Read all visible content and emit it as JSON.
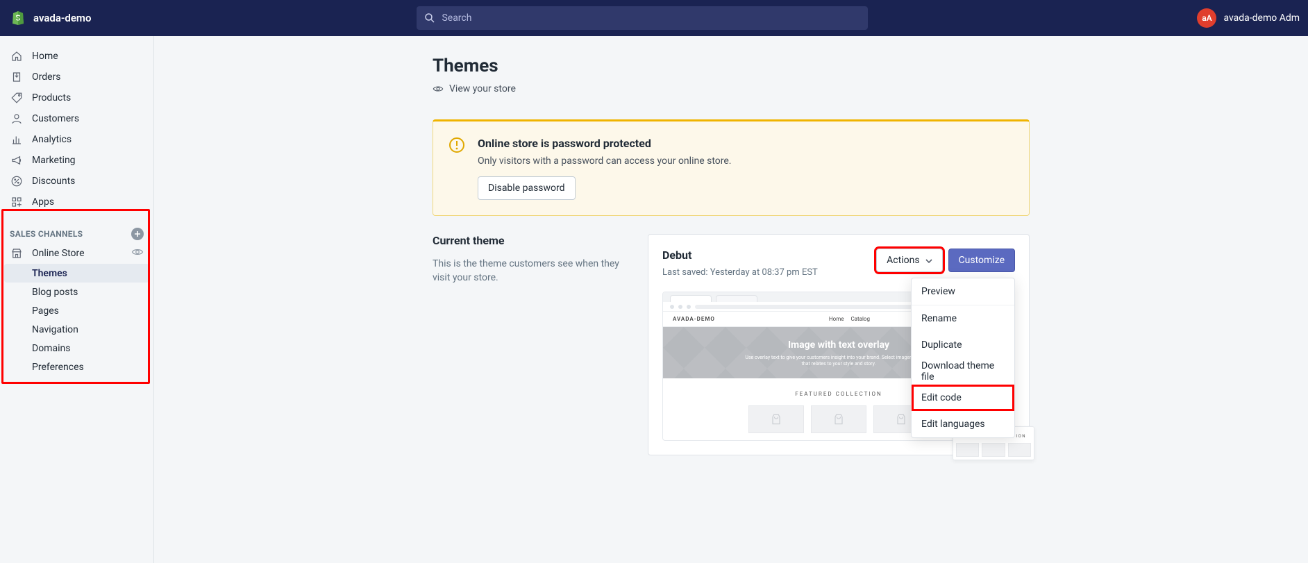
{
  "topbar": {
    "store_name": "avada-demo",
    "search_placeholder": "Search",
    "user_initials": "aA",
    "user_name": "avada-demo Adm"
  },
  "sidebar": {
    "items": [
      {
        "label": "Home"
      },
      {
        "label": "Orders"
      },
      {
        "label": "Products"
      },
      {
        "label": "Customers"
      },
      {
        "label": "Analytics"
      },
      {
        "label": "Marketing"
      },
      {
        "label": "Discounts"
      },
      {
        "label": "Apps"
      }
    ],
    "channels_header": "SALES CHANNELS",
    "online_store": "Online Store",
    "subitems": [
      {
        "label": "Themes"
      },
      {
        "label": "Blog posts"
      },
      {
        "label": "Pages"
      },
      {
        "label": "Navigation"
      },
      {
        "label": "Domains"
      },
      {
        "label": "Preferences"
      }
    ]
  },
  "page": {
    "title": "Themes",
    "view_store": "View your store",
    "banner": {
      "title": "Online store is password protected",
      "desc": "Only visitors with a password can access your online store.",
      "button": "Disable password"
    },
    "current_theme_heading": "Current theme",
    "current_theme_desc": "This is the theme customers see when they visit your store.",
    "theme_name": "Debut",
    "last_saved": "Last saved: Yesterday at 08:37 pm EST",
    "actions_label": "Actions",
    "customize_label": "Customize",
    "actions_menu": [
      "Preview",
      "Rename",
      "Duplicate",
      "Download theme file",
      "Edit code",
      "Edit languages"
    ],
    "preview": {
      "brand": "AVADA-DEMO",
      "nav_links": [
        "Home",
        "Catalog"
      ],
      "hero_title": "Image with text overlay",
      "hero_desc": "Use overlay text to give your customers insight into your brand. Select imagery and text that relates to your style and story.",
      "featured": "FEATURED COLLECTION"
    }
  }
}
